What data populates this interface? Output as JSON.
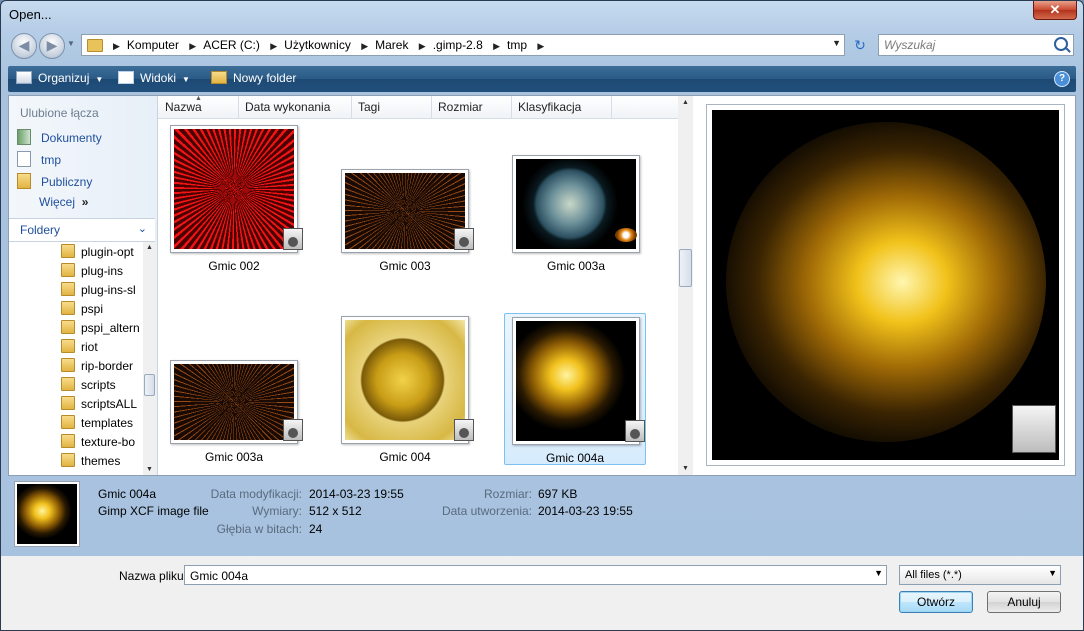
{
  "window": {
    "title": "Open...",
    "close": "✕"
  },
  "address": {
    "crumbs": [
      "Komputer",
      "ACER (C:)",
      "Użytkownicy",
      "Marek",
      ".gimp-2.8",
      "tmp"
    ],
    "search_placeholder": "Wyszukaj"
  },
  "toolbar": {
    "organize": "Organizuj",
    "views": "Widoki",
    "new_folder": "Nowy folder",
    "help": "?"
  },
  "nav": {
    "favorites_heading": "Ulubione łącza",
    "favorites": [
      "Dokumenty",
      "tmp",
      "Publiczny"
    ],
    "more": "Więcej",
    "more_arrows": "»",
    "folders_heading": "Foldery",
    "folders": [
      "plugin-opt",
      "plug-ins",
      "plug-ins-sl",
      "pspi",
      "pspi_altern",
      "riot",
      "rip-border",
      "scripts",
      "scriptsALL",
      "templates",
      "texture-bo",
      "themes"
    ]
  },
  "columns": [
    "Nazwa",
    "Data wykonania",
    "Tagi",
    "Rozmiar",
    "Klasyfikacja"
  ],
  "files": [
    {
      "name": "Gmic 002"
    },
    {
      "name": "Gmic 003"
    },
    {
      "name": "Gmic 003a"
    },
    {
      "name": "Gmic 003a"
    },
    {
      "name": "Gmic 004"
    },
    {
      "name": "Gmic 004a",
      "selected": true
    }
  ],
  "details": {
    "name": "Gmic 004a",
    "type": "Gimp XCF image file",
    "modified_label": "Data modyfikacji:",
    "modified": "2014-03-23 19:55",
    "dimensions_label": "Wymiary:",
    "dimensions": "512 x 512",
    "bitdepth_label": "Głębia w bitach:",
    "bitdepth": "24",
    "size_label": "Rozmiar:",
    "size": "697 KB",
    "created_label": "Data utworzenia:",
    "created": "2014-03-23 19:55"
  },
  "footer": {
    "filename_label": "Nazwa pliku:",
    "filename": "Gmic 004a",
    "filetype": "All files (*.*)",
    "open": "Otwórz",
    "cancel": "Anuluj"
  }
}
